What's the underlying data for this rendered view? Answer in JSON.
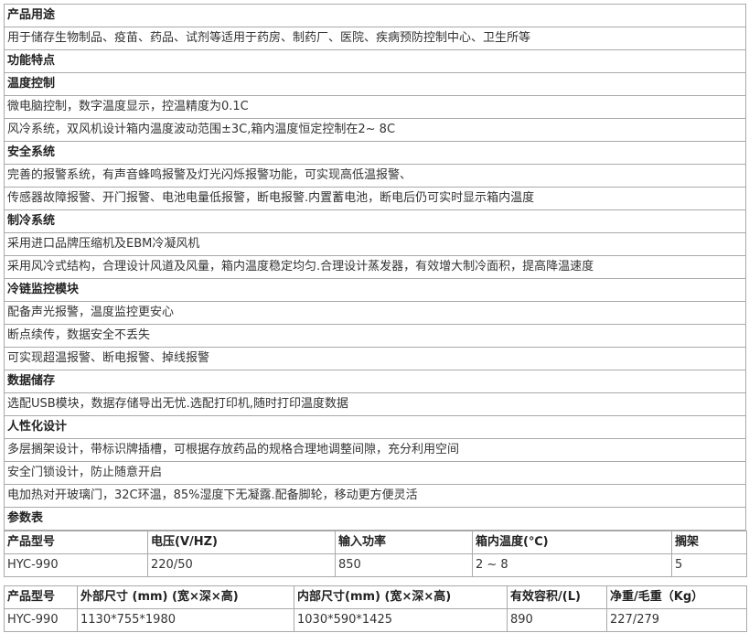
{
  "rows": [
    {
      "text": "产品用途",
      "bold": true
    },
    {
      "text": "用于储存生物制品、疫苗、药品、试剂等适用于药房、制药厂、医院、疾病预防控制中心、卫生所等",
      "bold": false
    },
    {
      "text": "功能特点",
      "bold": true
    },
    {
      "text": "温度控制",
      "bold": true
    },
    {
      "text": "微电脑控制，数字温度显示，控温精度为0.1C",
      "bold": false
    },
    {
      "text": "风冷系统，双风机设计箱内温度波动范围±3C,箱内温度恒定控制在2~ 8C",
      "bold": false
    },
    {
      "text": "安全系统",
      "bold": true
    },
    {
      "text": "完善的报警系统，有声音蜂鸣报警及灯光闪烁报警功能，可实现高低温报警、",
      "bold": false
    },
    {
      "text": "传感器故障报警、开门报警、电池电量低报警，断电报警.内置蓄电池，断电后仍可实时显示箱内温度",
      "bold": false
    },
    {
      "text": "制冷系统",
      "bold": true
    },
    {
      "text": "采用进口品牌压缩机及EBM冷凝风机",
      "bold": false
    },
    {
      "text": "采用风冷式结构，合理设计风道及风量，箱内温度稳定均匀.合理设计蒸发器，有效增大制冷面积，提高降温速度",
      "bold": false
    },
    {
      "text": "冷链监控模块",
      "bold": true
    },
    {
      "text": "配备声光报警，温度监控更安心",
      "bold": false
    },
    {
      "text": "断点续传，数据安全不丢失",
      "bold": false
    },
    {
      "text": "可实现超温报警、断电报警、掉线报警",
      "bold": false
    },
    {
      "text": "数据储存",
      "bold": true
    },
    {
      "text": "选配USB模块，数据存储导出无忧.选配打印机,随时打印温度数据",
      "bold": false
    },
    {
      "text": "人性化设计",
      "bold": true
    },
    {
      "text": "多层搁架设计，带标识牌插槽，可根据存放药品的规格合理地调整间隙，充分利用空间",
      "bold": false
    },
    {
      "text": "安全门锁设计，防止随意开启",
      "bold": false
    },
    {
      "text": "电加热对开玻璃门，32C环温，85%湿度下无凝露.配备脚轮，移动更方便灵活",
      "bold": false
    },
    {
      "text": "参数表",
      "bold": true
    }
  ],
  "spec_table_1": {
    "headers": [
      "产品型号",
      "电压(V/HZ)",
      "输入功率",
      "箱内温度(℃)",
      "搁架"
    ],
    "values": [
      "HYC-990",
      "220/50",
      "850",
      "2 ~ 8",
      "5"
    ]
  },
  "spec_table_2": {
    "headers": [
      "产品型号",
      "外部尺寸 (mm) (宽×深×高)",
      "内部尺寸(mm) (宽×深×高)",
      "有效容积/(L)",
      "净重/毛重（Kg）"
    ],
    "values": [
      "HYC-990",
      "1130*755*1980",
      "1030*590*1425",
      "890",
      "227/279"
    ]
  }
}
